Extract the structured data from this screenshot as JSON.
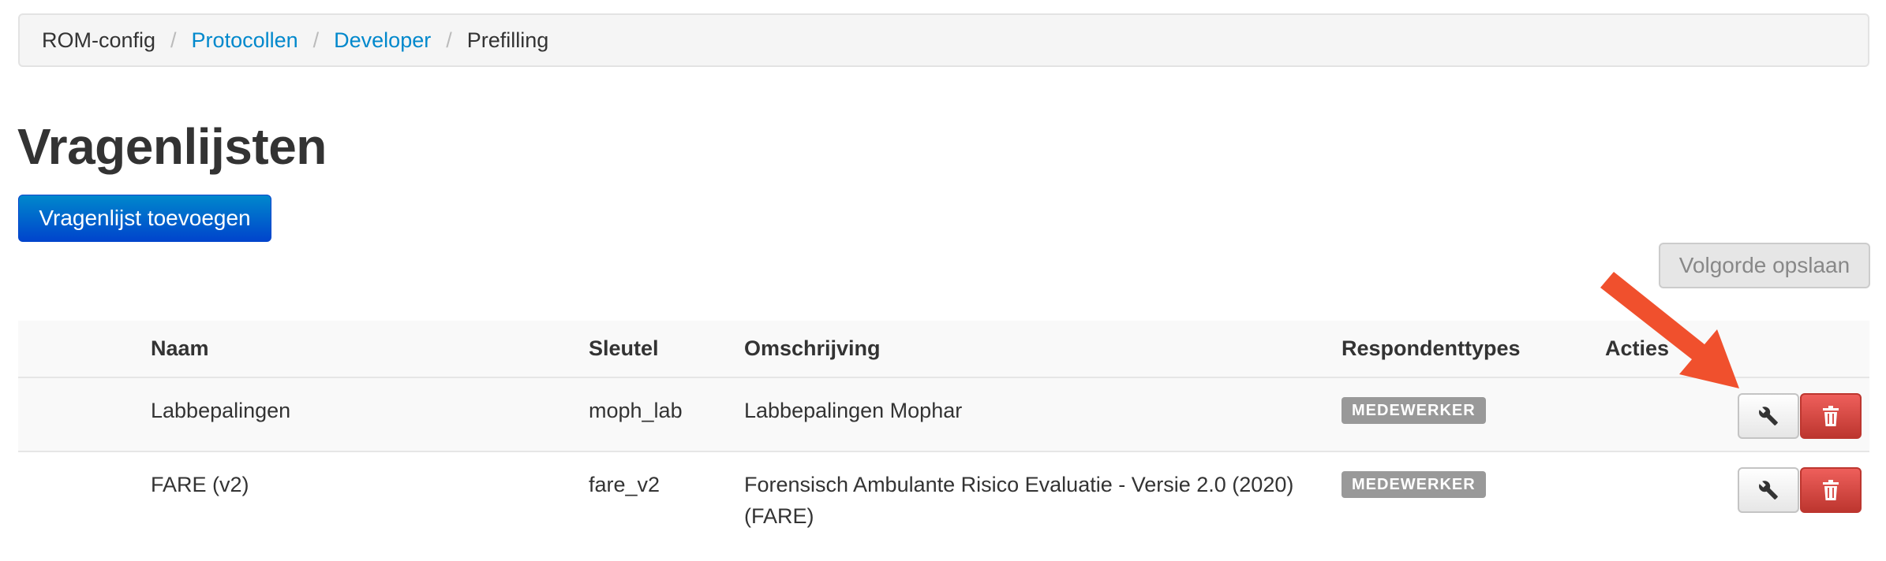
{
  "breadcrumb": {
    "items": [
      {
        "label": "ROM-config",
        "link": false
      },
      {
        "label": "Protocollen",
        "link": true
      },
      {
        "label": "Developer",
        "link": true
      },
      {
        "label": "Prefilling",
        "link": false
      }
    ],
    "separator": "/"
  },
  "page": {
    "title": "Vragenlijsten",
    "add_button_label": "Vragenlijst toevoegen",
    "save_order_label": "Volgorde opslaan"
  },
  "table": {
    "headers": {
      "naam": "Naam",
      "sleutel": "Sleutel",
      "omschrijving": "Omschrijving",
      "respondenttypes": "Respondenttypes",
      "acties": "Acties"
    },
    "rows": [
      {
        "naam": "Labbepalingen",
        "sleutel": "moph_lab",
        "omschrijving": "Labbepalingen Mophar",
        "respondenttype": "MEDEWERKER"
      },
      {
        "naam": "FARE (v2)",
        "sleutel": "fare_v2",
        "omschrijving": "Forensisch Ambulante Risico Evaluatie - Versie 2.0 (2020) (FARE)",
        "respondenttype": "MEDEWERKER"
      }
    ]
  },
  "icons": {
    "edit": "wrench-icon",
    "delete": "trash-icon",
    "annotation": "arrow-icon"
  },
  "colors": {
    "link": "#0088cc",
    "primary_button": "#0044cc",
    "danger_button": "#da4f49",
    "badge": "#999999",
    "annotation_arrow": "#f0502d"
  }
}
